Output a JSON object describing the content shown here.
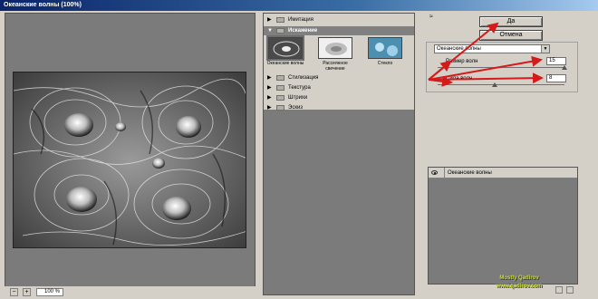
{
  "window": {
    "title": "Океанские волны (100%)"
  },
  "preview": {
    "zoom": "100 %",
    "zoom_minus": "−",
    "zoom_plus": "+"
  },
  "filters": {
    "categories": [
      {
        "label": "Имитация",
        "open": false
      },
      {
        "label": "Искажение",
        "open": true
      },
      {
        "label": "Стилизация",
        "open": false
      },
      {
        "label": "Текстура",
        "open": false
      },
      {
        "label": "Штрихи",
        "open": false
      },
      {
        "label": "Эскиз",
        "open": false
      }
    ],
    "thumbnails": [
      {
        "label": "Океанские волны",
        "selected": true
      },
      {
        "label": "Рассеянное свечение",
        "selected": false
      },
      {
        "label": "Стекло",
        "selected": false
      }
    ]
  },
  "buttons": {
    "ok": "Да",
    "cancel": "Отмена"
  },
  "settings": {
    "collapse_toggle": "≈",
    "filter_select": "Океанские волны",
    "params": [
      {
        "label": "Размер волн",
        "value": "15"
      },
      {
        "label": "Сила волн",
        "value": "8"
      }
    ]
  },
  "layers": {
    "items": [
      {
        "label": "Океанские волны"
      }
    ]
  },
  "watermark": {
    "line1": "Mostly Qadirov",
    "line2": "www.qadirov.com"
  },
  "colors": {
    "panel": "#d4d0c8",
    "workspace": "#7b7b7b",
    "annotation_arrow": "#d41a1a"
  }
}
